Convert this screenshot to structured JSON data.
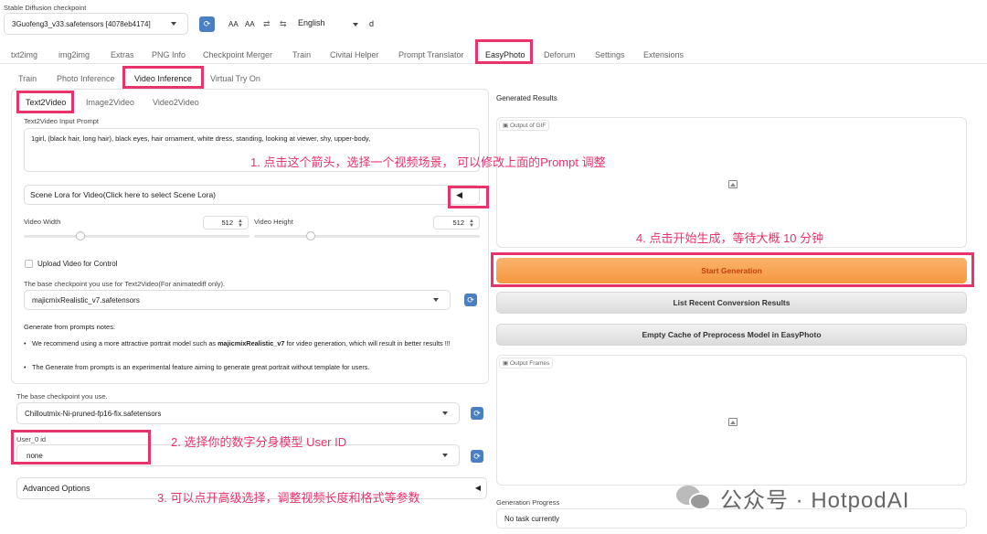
{
  "checkpoint": {
    "label": "Stable Diffusion checkpoint",
    "value": "3Guofeng3_v33.safetensors [4078eb4174]"
  },
  "toolbar": {
    "aa1": "AA",
    "aa2": "AA",
    "swap": "⇄",
    "lang_glyph": "⇆",
    "language": "English",
    "extra": "d"
  },
  "main_tabs": [
    "txt2img",
    "img2img",
    "Extras",
    "PNG Info",
    "Checkpoint Merger",
    "Train",
    "Civitai Helper",
    "Prompt Translator",
    "EasyPhoto",
    "Deforum",
    "Settings",
    "Extensions"
  ],
  "sub_tabs": [
    "Train",
    "Photo Inference",
    "Video Inference",
    "Virtual Try On"
  ],
  "mode_tabs": [
    "Text2Video",
    "Image2Video",
    "Video2Video"
  ],
  "prompt": {
    "label": "Text2Video Input Prompt",
    "value": "1girl, (black hair, long hair), black eyes, hair ornament, white dress, standing, looking at viewer, shy, upper-body,"
  },
  "scene_lora": {
    "label": "Scene Lora for Video(Click here to select Scene Lora)",
    "arrow": "◀"
  },
  "video_width": {
    "label": "Video Width",
    "value": "512",
    "fraction": 0.25
  },
  "video_height": {
    "label": "Video Height",
    "value": "512",
    "fraction": 0.25
  },
  "upload_video": {
    "label": "Upload Video for Control"
  },
  "text2video_ckpt": {
    "label": "The base checkpoint you use for Text2Video(For animatediff only).",
    "value": "majicmixRealistic_v7.safetensors"
  },
  "notes": {
    "title": "Generate from prompts notes:",
    "item1_pre": "We recommend using a more attractive portrait model such as ",
    "item1_bold": "majicmixRealistic_v7",
    "item1_post": " for video generation, which will result in better results !!!",
    "item2": "The Generate from prompts is an experimental feature aiming to generate great portrait without template for users."
  },
  "base_ckpt": {
    "label": "The base checkpoint you use.",
    "value": "Chilloutmix-Ni-pruned-fp16-fix.safetensors"
  },
  "user_id": {
    "label": "User_0 id",
    "value": "none"
  },
  "advanced": {
    "label": "Advanced Options",
    "arrow": "◀"
  },
  "results": {
    "label": "Generated Results",
    "gif_label": "Output of GIF",
    "start": "Start Generation",
    "list_recent": "List Recent Conversion Results",
    "empty_cache": "Empty Cache of Preprocess Model in EasyPhoto",
    "frames_label": "Output Frames",
    "progress_label": "Generation Progress",
    "progress_value": "No task currently"
  },
  "annotations": {
    "a1": "1. 点击这个箭头，选择一个视频场景， 可以修改上面的Prompt 调整",
    "a2": "2. 选择你的数字分身模型 User ID",
    "a3": "3. 可以点开高级选择，调整视频长度和格式等参数",
    "a4": "4. 点击开始生成，等待大概 10 分钟"
  },
  "watermark": "公众号 · HotpodAI",
  "colors": {
    "highlight": "#e8336b",
    "start_button": "#f6a04d",
    "refresh": "#4a7fc1"
  }
}
